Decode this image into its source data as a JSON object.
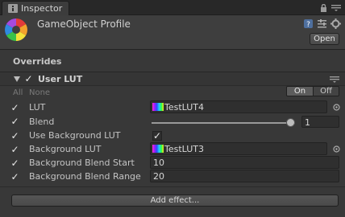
{
  "tab": {
    "label": "Inspector",
    "icon": "info-icon"
  },
  "header": {
    "title": "GameObject Profile",
    "open_label": "Open",
    "icon": "profile-aperture-icon"
  },
  "overrides_title": "Overrides",
  "effect": {
    "name": "User LUT",
    "enabled": true,
    "all_label": "All",
    "none_label": "None",
    "on_label": "On",
    "off_label": "Off"
  },
  "props": {
    "lut_label": "LUT",
    "lut_value": "TestLUT4",
    "blend_label": "Blend",
    "blend_value": "1",
    "blend_fraction": 1,
    "use_bg_label": "Use Background LUT",
    "use_bg_checked": true,
    "bg_lut_label": "Background LUT",
    "bg_lut_value": "TestLUT3",
    "bg_blend_start_label": "Background Blend Start",
    "bg_blend_start_value": "10",
    "bg_blend_range_label": "Background Blend Range",
    "bg_blend_range_value": "20"
  },
  "add_effect_label": "Add effect..."
}
